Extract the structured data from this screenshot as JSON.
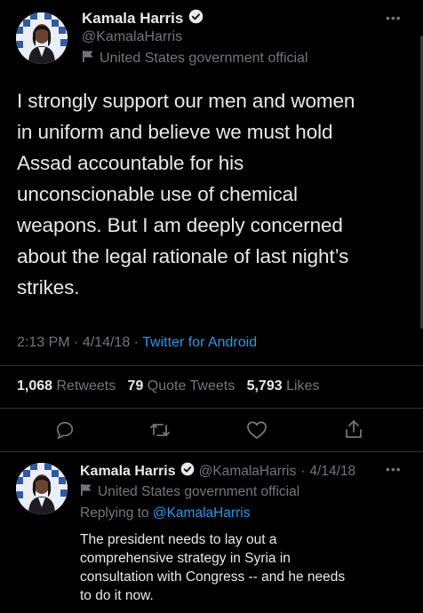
{
  "main_tweet": {
    "display_name": "Kamala Harris",
    "handle": "@KamalaHarris",
    "label": "United States government official",
    "lines": [
      "I strongly support our men and women",
      "in uniform and believe we must hold",
      "Assad accountable for his",
      "unconscionable use of chemical",
      "weapons. But I am deeply concerned",
      "about the legal rationale of last night’s",
      "strikes."
    ],
    "time": "2:13 PM",
    "date": "4/14/18",
    "source": "Twitter for Android",
    "retweets_count": "1,068",
    "retweets_label": "Retweets",
    "quotes_count": "79",
    "quotes_label": "Quote Tweets",
    "likes_count": "5,793",
    "likes_label": "Likes"
  },
  "reply_tweet": {
    "display_name": "Kamala Harris",
    "handle": "@KamalaHarris",
    "date": "4/14/18",
    "label": "United States government official",
    "replying_prefix": "Replying to",
    "replying_to": "@KamalaHarris",
    "lines": [
      "The president needs to lay out a",
      "comprehensive strategy in Syria in",
      "consultation with Congress -- and he needs",
      "to do it now."
    ]
  },
  "colors": {
    "accent": "#1d9bf0",
    "muted": "#71767b",
    "text": "#e7e9ea",
    "background": "#000000"
  },
  "icons": [
    "verified-badge-icon",
    "government-flag-icon",
    "reply-icon",
    "retweet-icon",
    "like-icon",
    "share-icon",
    "more-icon"
  ]
}
